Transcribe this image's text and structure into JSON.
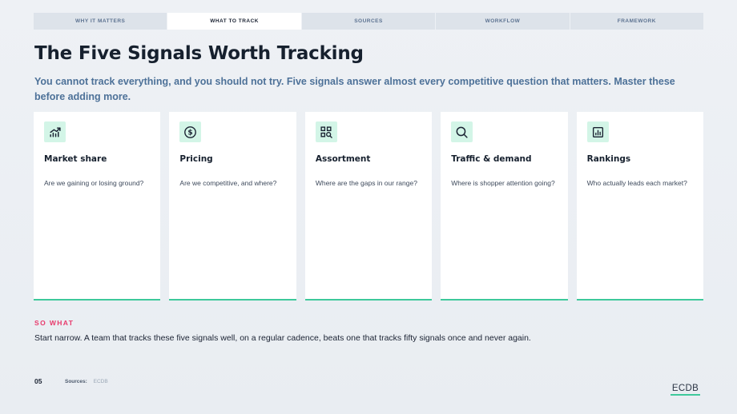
{
  "nav": {
    "tabs": [
      {
        "label": "WHY IT MATTERS",
        "active": false
      },
      {
        "label": "WHAT TO TRACK",
        "active": true
      },
      {
        "label": "SOURCES",
        "active": false
      },
      {
        "label": "WORKFLOW",
        "active": false
      },
      {
        "label": "FRAMEWORK",
        "active": false
      }
    ]
  },
  "header": {
    "title": "The Five Signals Worth Tracking",
    "subtitle": "You cannot track everything, and you should not try. Five signals answer almost every competitive question that matters. Master these before adding more."
  },
  "cards": [
    {
      "icon": "trend-up-icon",
      "title": "Market share",
      "text": "Are we gaining or losing ground?"
    },
    {
      "icon": "dollar-icon",
      "title": "Pricing",
      "text": "Are we competitive, and where?"
    },
    {
      "icon": "grid-search-icon",
      "title": "Assortment",
      "text": "Where are the gaps in our range?"
    },
    {
      "icon": "search-icon",
      "title": "Traffic & demand",
      "text": "Where is shopper attention going?"
    },
    {
      "icon": "bar-chart-icon",
      "title": "Rankings",
      "text": "Who actually leads each market?"
    }
  ],
  "so_what": {
    "label": "SO WHAT",
    "text": "Start narrow. A team that tracks these five signals well, on a regular cadence, beats one that tracks fifty signals once and never again."
  },
  "footer": {
    "page_number": "05",
    "sources_label": "Sources:",
    "sources_value": "ECDB",
    "logo": "ECDB"
  },
  "colors": {
    "accent": "#3ec99b",
    "icon_bg": "#d3f5e7",
    "highlight": "#e8396b",
    "subtitle": "#4d7198"
  }
}
